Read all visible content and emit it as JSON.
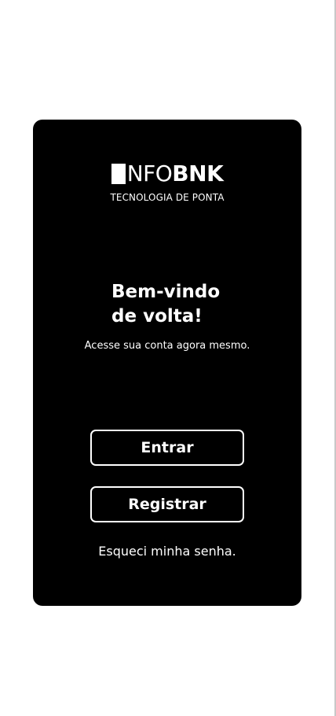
{
  "brand": {
    "logo_light": "NFO",
    "logo_bold": "BNK",
    "tagline": "TECNOLOGIA DE PONTA"
  },
  "welcome": {
    "headline_line1": "Bem-vindo",
    "headline_line2": "de volta!",
    "subtitle": "Acesse sua conta agora mesmo."
  },
  "actions": {
    "login_label": "Entrar",
    "register_label": "Registrar",
    "forgot_password_label": "Esqueci minha senha."
  },
  "colors": {
    "card_background": "#000000",
    "text": "#ffffff",
    "page_background": "#ffffff"
  }
}
